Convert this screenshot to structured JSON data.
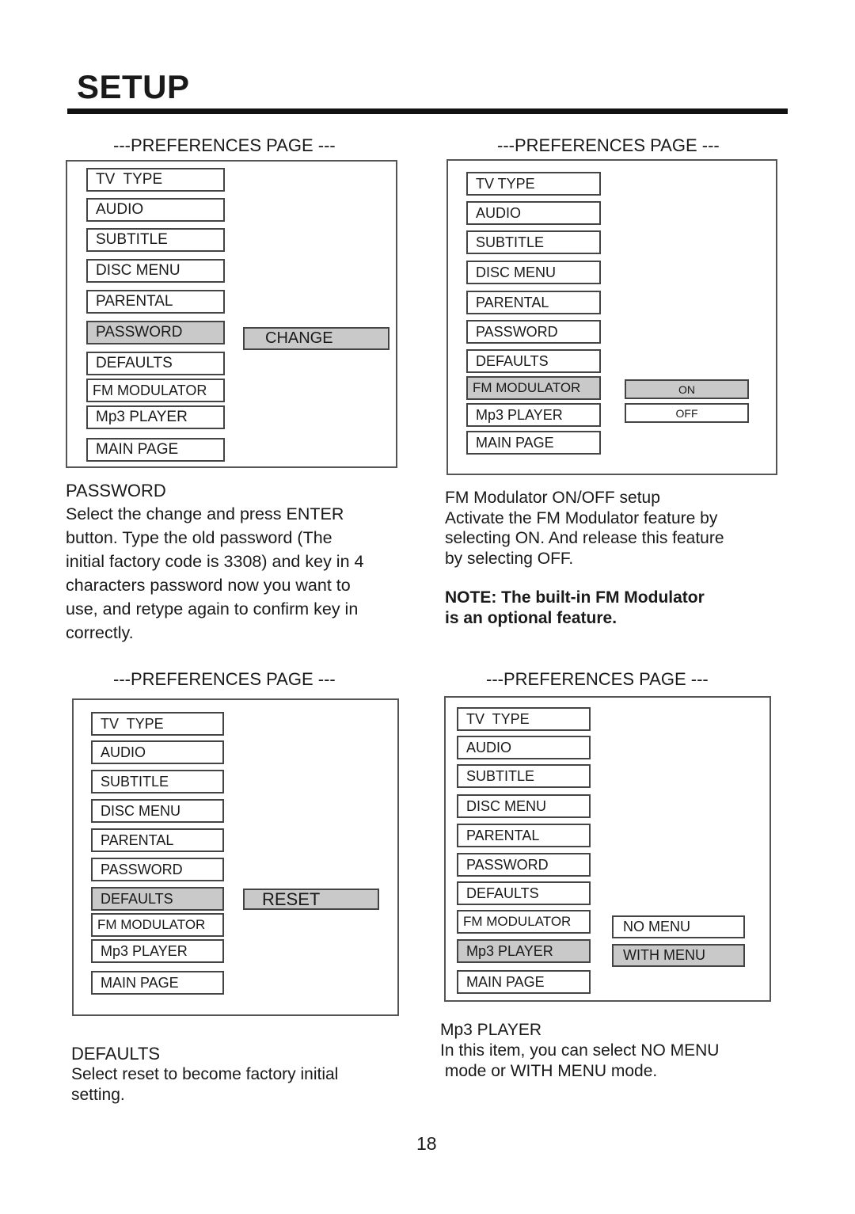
{
  "page": {
    "title": "SETUP",
    "page_number": "18"
  },
  "panels": [
    {
      "heading": "---PREFERENCES PAGE ---",
      "items": [
        "TV  TYPE",
        "AUDIO",
        "SUBTITLE",
        "DISC MENU",
        "PARENTAL",
        "PASSWORD",
        "DEFAULTS",
        "FM MODULATOR",
        "Mp3 PLAYER",
        "MAIN PAGE"
      ],
      "selected": "PASSWORD",
      "options": [
        {
          "label": "CHANGE",
          "selected": true
        }
      ]
    },
    {
      "heading": "---PREFERENCES PAGE ---",
      "items": [
        "TV TYPE",
        "AUDIO",
        "SUBTITLE",
        "DISC MENU",
        "PARENTAL",
        "PASSWORD",
        "DEFAULTS",
        "FM MODULATOR",
        "Mp3 PLAYER",
        "MAIN PAGE"
      ],
      "selected": "FM MODULATOR",
      "options": [
        {
          "label": "ON",
          "selected": true
        },
        {
          "label": "OFF",
          "selected": false
        }
      ]
    },
    {
      "heading": "---PREFERENCES PAGE ---",
      "items": [
        "TV  TYPE",
        "AUDIO",
        "SUBTITLE",
        "DISC MENU",
        "PARENTAL",
        "PASSWORD",
        "DEFAULTS",
        "FM MODULATOR",
        "Mp3 PLAYER",
        "MAIN PAGE"
      ],
      "selected": "DEFAULTS",
      "options": [
        {
          "label": "RESET",
          "selected": true
        }
      ]
    },
    {
      "heading": "---PREFERENCES PAGE ---",
      "items": [
        "TV  TYPE",
        "AUDIO",
        "SUBTITLE",
        "DISC MENU",
        "PARENTAL",
        "PASSWORD",
        "DEFAULTS",
        "FM MODULATOR",
        "Mp3 PLAYER",
        "MAIN PAGE"
      ],
      "selected": "Mp3 PLAYER",
      "options": [
        {
          "label": "NO MENU",
          "selected": false
        },
        {
          "label": "WITH MENU",
          "selected": true
        }
      ]
    }
  ],
  "descriptions": {
    "password": {
      "heading": "PASSWORD",
      "lines": [
        "Select the change and press ENTER",
        "button.  Type the old password (The",
        "initial factory code is 3308) and key in 4",
        "characters password now you want to",
        "use, and retype again to confirm key in",
        "correctly."
      ]
    },
    "fm": {
      "lines": [
        "FM Modulator ON/OFF setup",
        "Activate the FM Modulator feature by",
        "selecting ON.  And release this feature",
        "by selecting OFF."
      ],
      "note_lines": [
        "NOTE: The built-in FM Modulator",
        "is an optional feature."
      ]
    },
    "defaults": {
      "heading": "DEFAULTS",
      "lines": [
        "Select reset to become factory initial",
        "setting."
      ]
    },
    "mp3": {
      "heading": "Mp3 PLAYER",
      "lines": [
        "In this item, you can select NO MENU",
        " mode or WITH MENU mode."
      ]
    }
  }
}
